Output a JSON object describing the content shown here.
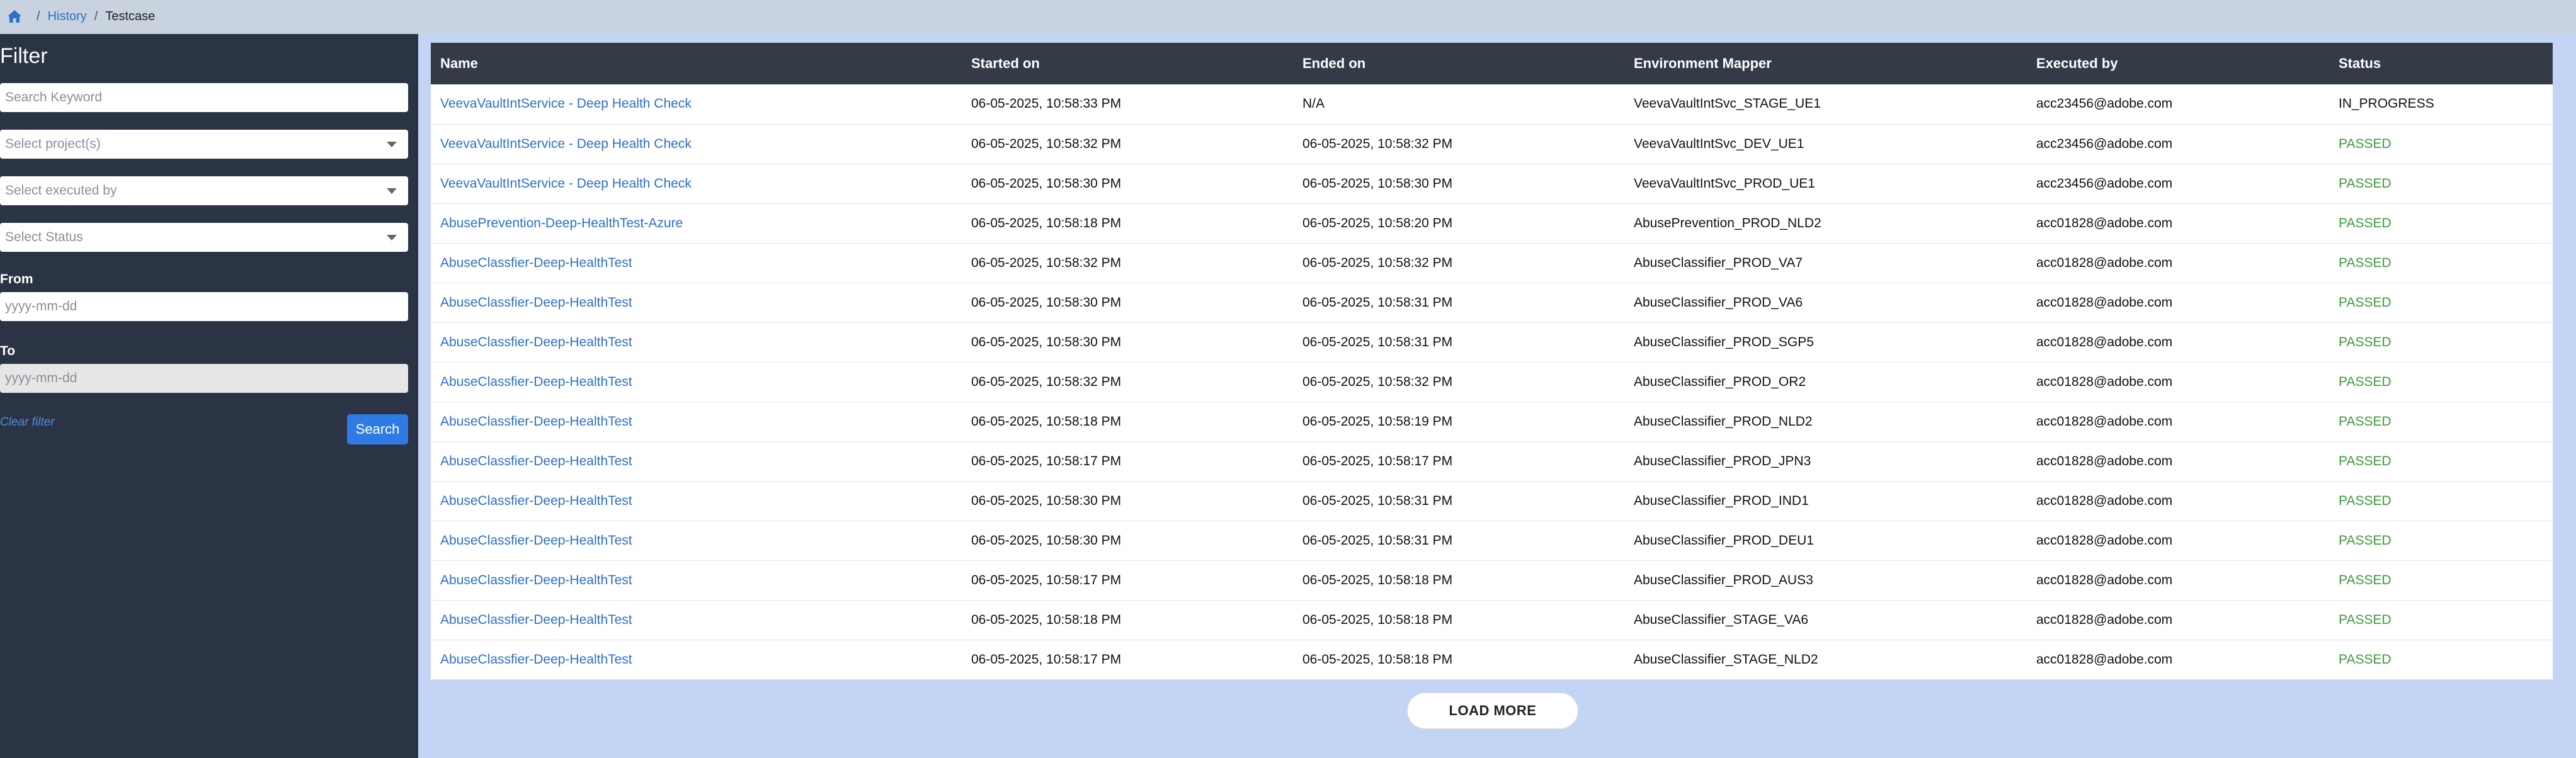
{
  "breadcrumb": {
    "home_icon": "home-icon",
    "items": [
      {
        "label": "History"
      },
      {
        "label": "Testcase"
      }
    ],
    "separator": "/"
  },
  "filter": {
    "title": "Filter",
    "keyword_placeholder": "Search Keyword",
    "project_placeholder": "Select project(s)",
    "executed_by_placeholder": "Select executed by",
    "status_placeholder": "Select Status",
    "from_label": "From",
    "from_placeholder": "yyyy-mm-dd",
    "to_label": "To",
    "to_placeholder": "yyyy-mm-dd",
    "clear_label": "Clear filter",
    "search_label": "Search"
  },
  "table": {
    "columns": [
      "Name",
      "Started on",
      "Ended on",
      "Environment Mapper",
      "Executed by",
      "Status"
    ],
    "rows": [
      [
        "VeevaVaultIntService - Deep Health Check",
        "06-05-2025, 10:58:33 PM",
        "N/A",
        "VeevaVaultIntSvc_STAGE_UE1",
        "acc23456@adobe.com",
        "IN_PROGRESS"
      ],
      [
        "VeevaVaultIntService - Deep Health Check",
        "06-05-2025, 10:58:32 PM",
        "06-05-2025, 10:58:32 PM",
        "VeevaVaultIntSvc_DEV_UE1",
        "acc23456@adobe.com",
        "PASSED"
      ],
      [
        "VeevaVaultIntService - Deep Health Check",
        "06-05-2025, 10:58:30 PM",
        "06-05-2025, 10:58:30 PM",
        "VeevaVaultIntSvc_PROD_UE1",
        "acc23456@adobe.com",
        "PASSED"
      ],
      [
        "AbusePrevention-Deep-HealthTest-Azure",
        "06-05-2025, 10:58:18 PM",
        "06-05-2025, 10:58:20 PM",
        "AbusePrevention_PROD_NLD2",
        "acc01828@adobe.com",
        "PASSED"
      ],
      [
        "AbuseClassfier-Deep-HealthTest",
        "06-05-2025, 10:58:32 PM",
        "06-05-2025, 10:58:32 PM",
        "AbuseClassifier_PROD_VA7",
        "acc01828@adobe.com",
        "PASSED"
      ],
      [
        "AbuseClassfier-Deep-HealthTest",
        "06-05-2025, 10:58:30 PM",
        "06-05-2025, 10:58:31 PM",
        "AbuseClassifier_PROD_VA6",
        "acc01828@adobe.com",
        "PASSED"
      ],
      [
        "AbuseClassfier-Deep-HealthTest",
        "06-05-2025, 10:58:30 PM",
        "06-05-2025, 10:58:31 PM",
        "AbuseClassifier_PROD_SGP5",
        "acc01828@adobe.com",
        "PASSED"
      ],
      [
        "AbuseClassfier-Deep-HealthTest",
        "06-05-2025, 10:58:32 PM",
        "06-05-2025, 10:58:32 PM",
        "AbuseClassifier_PROD_OR2",
        "acc01828@adobe.com",
        "PASSED"
      ],
      [
        "AbuseClassfier-Deep-HealthTest",
        "06-05-2025, 10:58:18 PM",
        "06-05-2025, 10:58:19 PM",
        "AbuseClassifier_PROD_NLD2",
        "acc01828@adobe.com",
        "PASSED"
      ],
      [
        "AbuseClassfier-Deep-HealthTest",
        "06-05-2025, 10:58:17 PM",
        "06-05-2025, 10:58:17 PM",
        "AbuseClassifier_PROD_JPN3",
        "acc01828@adobe.com",
        "PASSED"
      ],
      [
        "AbuseClassfier-Deep-HealthTest",
        "06-05-2025, 10:58:30 PM",
        "06-05-2025, 10:58:31 PM",
        "AbuseClassifier_PROD_IND1",
        "acc01828@adobe.com",
        "PASSED"
      ],
      [
        "AbuseClassfier-Deep-HealthTest",
        "06-05-2025, 10:58:30 PM",
        "06-05-2025, 10:58:31 PM",
        "AbuseClassifier_PROD_DEU1",
        "acc01828@adobe.com",
        "PASSED"
      ],
      [
        "AbuseClassfier-Deep-HealthTest",
        "06-05-2025, 10:58:17 PM",
        "06-05-2025, 10:58:18 PM",
        "AbuseClassifier_PROD_AUS3",
        "acc01828@adobe.com",
        "PASSED"
      ],
      [
        "AbuseClassfier-Deep-HealthTest",
        "06-05-2025, 10:58:18 PM",
        "06-05-2025, 10:58:18 PM",
        "AbuseClassifier_STAGE_VA6",
        "acc01828@adobe.com",
        "PASSED"
      ],
      [
        "AbuseClassfier-Deep-HealthTest",
        "06-05-2025, 10:58:17 PM",
        "06-05-2025, 10:58:18 PM",
        "AbuseClassifier_STAGE_NLD2",
        "acc01828@adobe.com",
        "PASSED"
      ]
    ]
  },
  "load_more_label": "LOAD MORE",
  "colors": {
    "sidebar_bg": "#2b3444",
    "header_bg": "#343b47",
    "main_bg": "#c4d4f4",
    "link": "#2d6fc9",
    "passed": "#3a9a3a",
    "search_button": "#2f7be5"
  }
}
